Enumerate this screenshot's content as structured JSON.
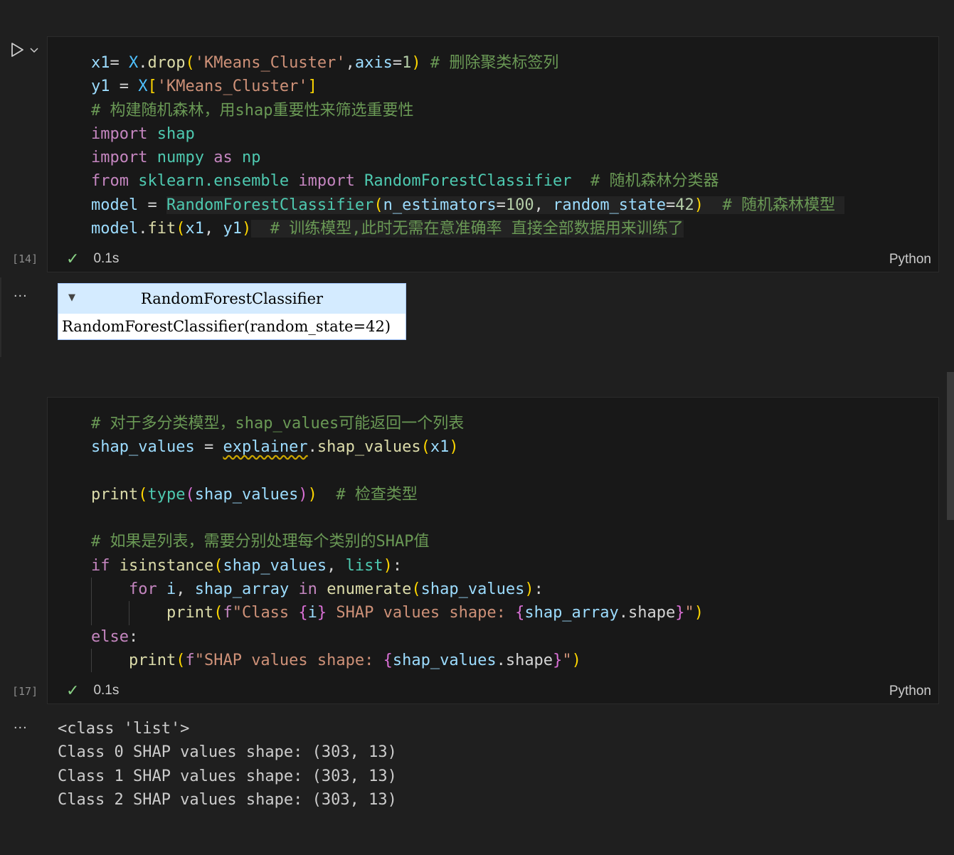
{
  "cell1": {
    "exec_count": "[14]",
    "time": "0.1s",
    "language": "Python",
    "lines": [
      "x1= X.drop('KMeans_Cluster',axis=1) # 删除聚类标签列",
      "y1 = X['KMeans_Cluster']",
      "# 构建随机森林，用shap重要性来筛选重要性",
      "import shap",
      "import numpy as np",
      "from sklearn.ensemble import RandomForestClassifier  # 随机森林分类器",
      "model = RandomForestClassifier(n_estimators=100, random_state=42)  # 随机森林模型",
      "model.fit(x1, y1)  # 训练模型,此时无需在意准确率 直接全部数据用来训练了"
    ]
  },
  "widget": {
    "title": "RandomForestClassifier",
    "repr": "RandomForestClassifier(random_state=42)"
  },
  "cell2": {
    "exec_count": "[17]",
    "time": "0.1s",
    "language": "Python",
    "lines": [
      "# 对于多分类模型，shap_values可能返回一个列表",
      "shap_values = explainer.shap_values(x1)",
      "",
      "print(type(shap_values))  # 检查类型",
      "",
      "# 如果是列表，需要分别处理每个类别的SHAP值",
      "if isinstance(shap_values, list):",
      "    for i, shap_array in enumerate(shap_values):",
      "        print(f\"Class {i} SHAP values shape: {shap_array.shape}\")",
      "else:",
      "    print(f\"SHAP values shape: {shap_values.shape}\")"
    ]
  },
  "output2": {
    "lines": [
      "<class 'list'>",
      "Class 0 SHAP values shape: (303, 13)",
      "Class 1 SHAP values shape: (303, 13)",
      "Class 2 SHAP values shape: (303, 13)"
    ]
  },
  "ui": {
    "more_actions": "...",
    "collapse_glyph": "▼",
    "check_glyph": "✓",
    "icons": [
      "run-icon",
      "chevron-down-icon",
      "check-icon",
      "more-actions-icon"
    ]
  }
}
